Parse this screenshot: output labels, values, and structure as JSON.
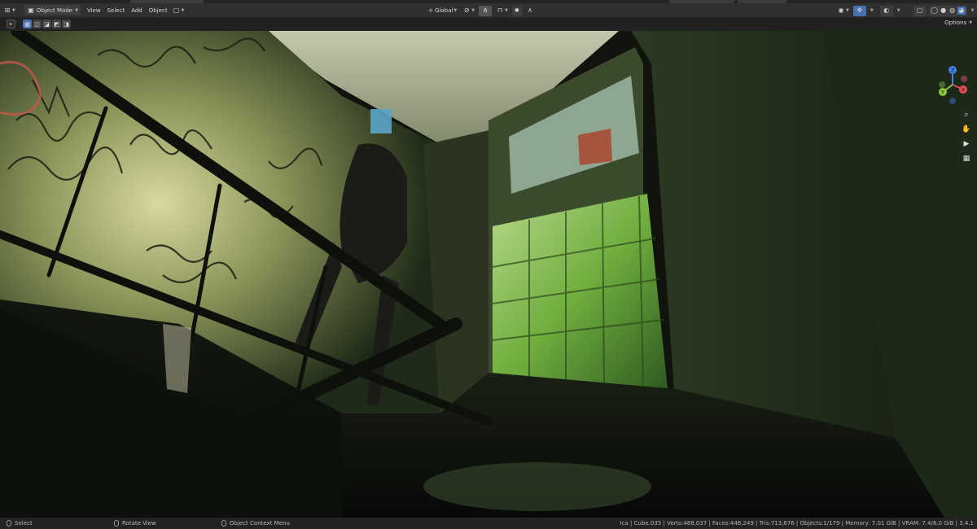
{
  "header": {
    "mode": "Object Mode",
    "menus": [
      "View",
      "Select",
      "Add",
      "Object"
    ],
    "transform_orientation": "Global",
    "options_label": "Options"
  },
  "icons": {
    "editor_type": "viewport-icon",
    "object_mode": "object-mode-icon",
    "pivot": "pivot-point-icon",
    "snap": "snap-icon",
    "proportional": "proportional-editing-icon",
    "visibility": "visibility-icon",
    "gizmo": "gizmo-icon",
    "overlays": "overlays-icon",
    "xray": "xray-icon",
    "shading": [
      "wireframe-icon",
      "solid-icon",
      "material-preview-icon",
      "rendered-icon"
    ],
    "navigation": [
      "zoom-icon",
      "pan-icon",
      "camera-icon",
      "grid-icon"
    ]
  },
  "gizmo_axes": {
    "x": "X",
    "y": "Y",
    "z": "Z"
  },
  "colors": {
    "accent": "#4772b3",
    "axis_x": "#e04b5a",
    "axis_y": "#8bc63f",
    "axis_z": "#3f80e8"
  },
  "status": {
    "left_click": "Select",
    "middle_click": "Rotate View",
    "right_click": "Object Context Menu",
    "stats": "Ica | Cube.035 | Verts:488,037 | Faces:448,249 | Tris:713,676 | Objects:1/179 | Memory: 7.01 GiB | VRAM: 7.4/8.0 GiB | 3.4.1"
  }
}
